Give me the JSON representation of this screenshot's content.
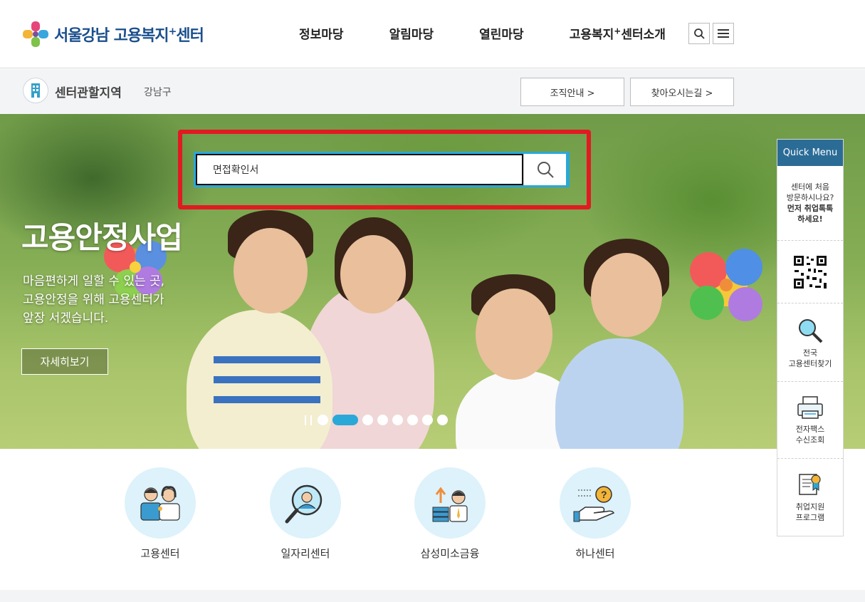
{
  "header": {
    "logo_text": "서울강남 고용복지",
    "logo_plus": "+",
    "logo_suffix": "센터",
    "nav": [
      {
        "label": "정보마당"
      },
      {
        "label": "알림마당"
      },
      {
        "label": "열린마당"
      },
      {
        "label_main": "고용복지",
        "label_plus": "+",
        "label_suffix": "센터소개"
      }
    ]
  },
  "subbar": {
    "title": "센터관할지역",
    "region": "강남구",
    "org_button": "조직안내 >",
    "directions_button": "찾아오시는길 >"
  },
  "search": {
    "value": "면접확인서"
  },
  "hero": {
    "title": "고용안정사업",
    "desc": [
      "마음편하게 일할 수 있는 곳,",
      "고용안정을 위해 고용센터가",
      "앞장 서겠습니다."
    ],
    "more_button": "자세히보기",
    "slide_count": 8,
    "active_slide": 2
  },
  "quick_menu": {
    "title": "Quick Menu",
    "intro_lines": [
      "센터에 처음",
      "방문하시나요?"
    ],
    "intro_strong": [
      "먼저 취업톡톡",
      "하세요!"
    ],
    "items": [
      {
        "icon": "qr-code-icon",
        "label": []
      },
      {
        "icon": "magnifier-icon",
        "label": [
          "전국",
          "고용센터찾기"
        ]
      },
      {
        "icon": "fax-icon",
        "label": [
          "전자팩스",
          "수신조회"
        ]
      },
      {
        "icon": "certificate-icon",
        "label": [
          "취업지원",
          "프로그램"
        ]
      }
    ]
  },
  "services": [
    {
      "label": "고용센터",
      "icon": "people-icon"
    },
    {
      "label": "일자리센터",
      "icon": "job-search-icon"
    },
    {
      "label": "삼성미소금융",
      "icon": "finance-icon"
    },
    {
      "label": "하나센터",
      "icon": "help-hand-icon"
    }
  ],
  "colors": {
    "brand": "#1a4f8c",
    "accent": "#2aa8d8",
    "highlight": "#e11a22",
    "quick_head": "#2b6c97"
  }
}
